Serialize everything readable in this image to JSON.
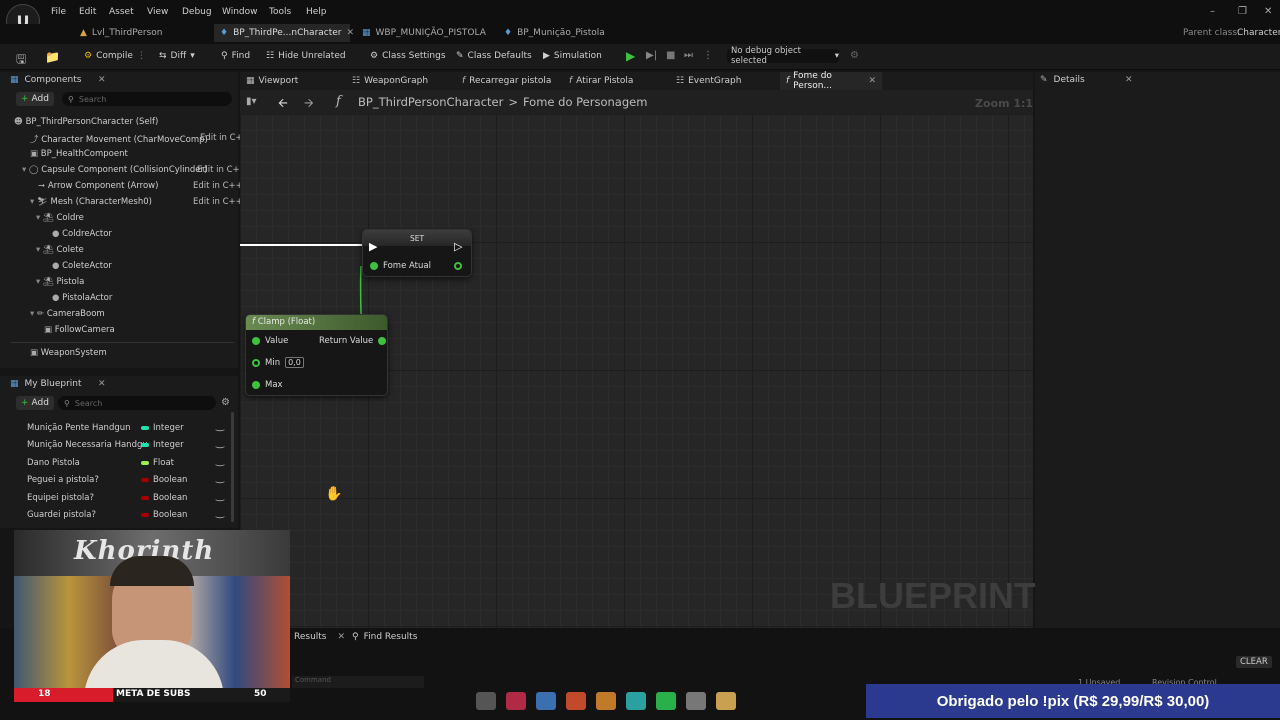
{
  "menu": {
    "items": [
      "File",
      "Edit",
      "Asset",
      "View",
      "Debug",
      "Window",
      "Tools",
      "Help"
    ]
  },
  "tabs": [
    {
      "label": "Lvl_ThirdPerson"
    },
    {
      "label": "BP_ThirdPe...nCharacter"
    },
    {
      "label": "WBP_MUNIÇÃO_PISTOLA"
    },
    {
      "label": "BP_Munição_Pistola"
    }
  ],
  "parent_class": {
    "label": "Parent class:",
    "value": "Character"
  },
  "toolbar": {
    "compile": "Compile",
    "diff": "Diff",
    "find": "Find",
    "hide_unrelated": "Hide Unrelated",
    "class_settings": "Class Settings",
    "class_defaults": "Class Defaults",
    "simulation": "Simulation",
    "debug_object": "No debug object selected"
  },
  "components": {
    "title": "Components",
    "add": "Add",
    "search_placeholder": "Search",
    "items": [
      {
        "label": "BP_ThirdPersonCharacter (Self)",
        "edit": ""
      },
      {
        "label": "Character Movement (CharMoveComp)",
        "edit": "Edit in C+"
      },
      {
        "label": "BP_HealthCompoent",
        "edit": ""
      },
      {
        "label": "Capsule Component (CollisionCylinder)",
        "edit": "Edit in C+"
      },
      {
        "label": "Arrow Component (Arrow)",
        "edit": "Edit in C++"
      },
      {
        "label": "Mesh (CharacterMesh0)",
        "edit": "Edit in C++"
      },
      {
        "label": "Coldre",
        "edit": ""
      },
      {
        "label": "ColdreActor",
        "edit": ""
      },
      {
        "label": "Colete",
        "edit": ""
      },
      {
        "label": "ColeteActor",
        "edit": ""
      },
      {
        "label": "Pistola",
        "edit": ""
      },
      {
        "label": "PistolaActor",
        "edit": ""
      },
      {
        "label": "CameraBoom",
        "edit": ""
      },
      {
        "label": "FollowCamera",
        "edit": ""
      },
      {
        "label": "WeaponSystem",
        "edit": ""
      }
    ]
  },
  "my_blueprint": {
    "title": "My Blueprint",
    "add": "Add",
    "search_placeholder": "Search",
    "vars": [
      {
        "name": "Munição Pente Handgun",
        "type": "Integer",
        "color": "#1fe3af"
      },
      {
        "name": "Munição Necessaria Handgu",
        "type": "Integer",
        "color": "#1fe3af"
      },
      {
        "name": "Dano Pistola",
        "type": "Float",
        "color": "#9cf04a"
      },
      {
        "name": "Peguei a pistola?",
        "type": "Boolean",
        "color": "#a50000"
      },
      {
        "name": "Equipei pistola?",
        "type": "Boolean",
        "color": "#a50000"
      },
      {
        "name": "Guardei pistola?",
        "type": "Boolean",
        "color": "#a50000"
      }
    ]
  },
  "graph_tabs": [
    "Viewport",
    "WeaponGraph",
    "Recarregar pistola",
    "Atirar Pistola",
    "EventGraph",
    "Fome do Person..."
  ],
  "breadcrumb": {
    "root": "BP_ThirdPersonCharacter",
    "sep": ">",
    "current": "Fome do Personagem"
  },
  "zoom": "Zoom 1:1",
  "details": {
    "title": "Details"
  },
  "nodes": {
    "set": {
      "title": "SET",
      "pin": "Fome Atual"
    },
    "clamp": {
      "title": "Clamp (Float)",
      "value": "Value",
      "return": "Return Value",
      "min": "Min",
      "min_val": "0,0",
      "max": "Max"
    }
  },
  "watermark": "BLUEPRINT",
  "bottom": {
    "results": "Results",
    "find_results": "Find Results",
    "clear": "CLEAR",
    "command_placeholder": "Command",
    "unsaved": "1 Unsaved",
    "revision": "Revision Control"
  },
  "webcam": {
    "sub_label": "META DE SUBS",
    "current": "18",
    "goal": "50",
    "sign": "Khorinth"
  },
  "donation": "Obrigado pelo !pix (R$ 29,99/R$ 30,00)",
  "colors": {
    "float_pin": "#3ec13e",
    "integer": "#1fe3af",
    "boolean": "#a50000",
    "accent": "#3b82f6"
  }
}
